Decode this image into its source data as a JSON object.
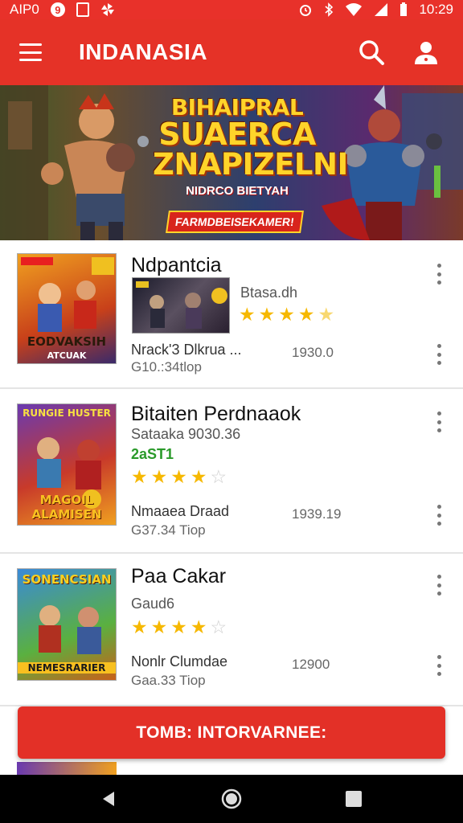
{
  "status_bar": {
    "left_text": "AIP0",
    "left_badge": "9",
    "time": "10:29",
    "icons": [
      "notification-icon",
      "gallery-icon",
      "pinwheel-icon",
      "alarm-icon",
      "bluetooth-icon",
      "wifi-icon",
      "signal-icon",
      "battery-icon"
    ]
  },
  "app_bar": {
    "title": "INDANASIA",
    "menu_icon": "hamburger-menu-icon",
    "search_icon": "search-icon",
    "profile_icon": "profile-icon"
  },
  "banner": {
    "line1": "BIHAIPRAL",
    "line2": "SUAERCA",
    "line3": "ZNAPIZELNI",
    "subtitle": "NIDRCO BIETYAH",
    "ribbon": "FARMDBEISEKAMER!"
  },
  "games": [
    {
      "title": "Ndpantcia",
      "thumb_label_top": "",
      "thumb_label_bottom": "EODVAKSIH",
      "thumb_label_bottom2": "ATCUAK",
      "sub": "Btasa.dh",
      "green": "",
      "stars": 4.5,
      "developer": "Nrack'3 Dlkrua ...",
      "size": "G10.:34tlop",
      "count": "1930.0"
    },
    {
      "title": "Bitaiten Perdnaaok",
      "thumb_label_top": "RUNGIE HUSTER",
      "thumb_label_bottom": "MAGOIL ALAMISEN",
      "thumb_label_bottom2": "",
      "sub": "Sataaka 9030.36",
      "green": "2aST1",
      "stars": 4,
      "developer": "Nmaaea Draad",
      "size": "G37.34 Tiop",
      "count": "1939.19"
    },
    {
      "title": "Paa Cakar",
      "thumb_label_top": "SONENCSIAN",
      "thumb_label_bottom": "NEMESRARIER",
      "thumb_label_bottom2": "",
      "sub": "Gaud6",
      "green": "",
      "stars": 4,
      "developer": "Nonlr Clumdae",
      "size": "Gaa.33 Tiop",
      "count": "12900"
    }
  ],
  "cta": {
    "label": "TOMB: INTORVARNEE:"
  },
  "nav": {
    "back_icon": "back-triangle-icon",
    "home_icon": "home-circle-icon",
    "recents_icon": "recents-square-icon"
  },
  "colors": {
    "primary": "#e53227",
    "star": "#f6b800",
    "green_text": "#2a9a2a"
  }
}
